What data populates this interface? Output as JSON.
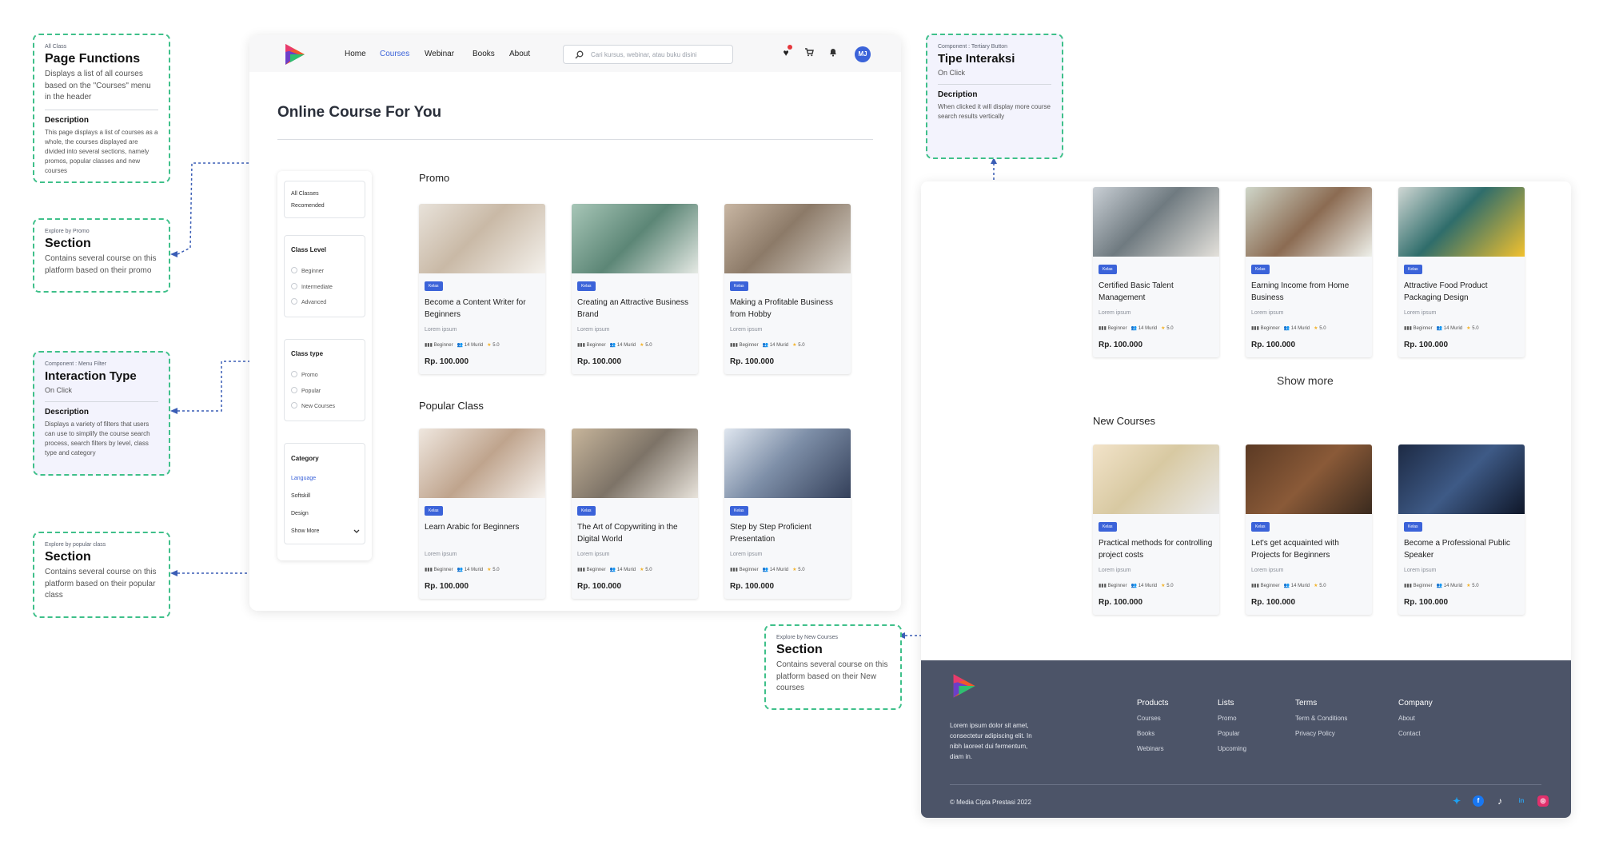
{
  "annotations": {
    "page_functions": {
      "caption": "All Class",
      "title": "Page Functions",
      "subtitle": "Displays a list of all courses based on the \"Courses\" menu in the header",
      "desc_head": "Description",
      "desc": "This page displays a list of courses as a whole, the courses displayed are divided into several sections, namely promos, popular classes and new courses"
    },
    "promo_section": {
      "caption": "Explore by Promo",
      "title": "Section",
      "subtitle": "Contains several course on this platform based on their promo"
    },
    "interaction_type": {
      "caption": "Component : Menu Filter",
      "title": "Interaction Type",
      "subtitle": "On Click",
      "desc_head": "Description",
      "desc": "Displays a variety of filters that users can use to simplify the course search process, search filters by level, class type and category"
    },
    "popular_section": {
      "caption": "Explore by popular class",
      "title": "Section",
      "subtitle": "Contains several course on this platform based on their popular class"
    },
    "tipe_interaksi": {
      "caption": "Component : Tertiary Button",
      "title": "Tipe Interaksi",
      "subtitle": "On Click",
      "desc_head": "Decription",
      "desc": "When clicked it will display more course search results vertically"
    },
    "new_section": {
      "caption": "Explore by New Courses",
      "title": "Section",
      "subtitle": "Contains several course on this platform based on their New courses"
    }
  },
  "header": {
    "nav": [
      "Home",
      "Courses",
      "Webinar",
      "Books",
      "About"
    ],
    "active": "Courses",
    "search_placeholder": "Cari kursus, webinar, atau buku disini",
    "avatar_initials": "MJ"
  },
  "page_title": "Online Course For You",
  "filter": {
    "quick": [
      "All Classes",
      "Recomended"
    ],
    "level": {
      "title": "Class Level",
      "options": [
        "Beginner",
        "Intermediate",
        "Advanced"
      ]
    },
    "type": {
      "title": "Class type",
      "options": [
        "Promo",
        "Popular",
        "New Courses"
      ]
    },
    "category": {
      "title": "Category",
      "options": [
        "Language",
        "Softskill",
        "Design"
      ],
      "show_more": "Show More"
    }
  },
  "card_common": {
    "tag": "Kelas",
    "desc": "Lorem ipsum",
    "level": "Beginner",
    "students": "14 Murid",
    "rating": "5.0",
    "price": "Rp. 100.000"
  },
  "sections": {
    "promo": {
      "title": "Promo",
      "courses": [
        "Become a Content Writer for Beginners",
        "Creating an Attractive Business Brand",
        "Making a Profitable Business from Hobby"
      ]
    },
    "popular": {
      "title": "Popular Class",
      "courses": [
        "Learn Arabic for Beginners",
        "The Art of Copywriting in the Digital World",
        "Step by Step Proficient Presentation"
      ]
    },
    "more": {
      "courses": [
        "Certified Basic Talent Management",
        "Earning Income from Home Business",
        "Attractive Food Product Packaging Design"
      ]
    },
    "new": {
      "title": "New Courses",
      "courses": [
        "Practical methods for controlling project costs",
        "Let's get acquainted with Projects for Beginners",
        "Become a Professional Public Speaker"
      ]
    }
  },
  "show_more": "Show more",
  "footer": {
    "about": "Lorem ipsum dolor sit amet, consectetur adipiscing elit. In nibh laoreet dui fermentum, diam in.",
    "columns": [
      {
        "title": "Products",
        "links": [
          "Courses",
          "Books",
          "Webinars"
        ]
      },
      {
        "title": "Lists",
        "links": [
          "Promo",
          "Popular",
          "Upcoming"
        ]
      },
      {
        "title": "Terms",
        "links": [
          "Term & Conditions",
          "Privacy Policy"
        ]
      },
      {
        "title": "Company",
        "links": [
          "About",
          "Contact"
        ]
      }
    ],
    "copyright": "© Media Cipta Prestasi 2022"
  },
  "colors": {
    "accent": "#3b63d9",
    "annotation_border": "#3fc08a",
    "connector": "#3a5db5",
    "footer_bg": "#4c5468"
  }
}
